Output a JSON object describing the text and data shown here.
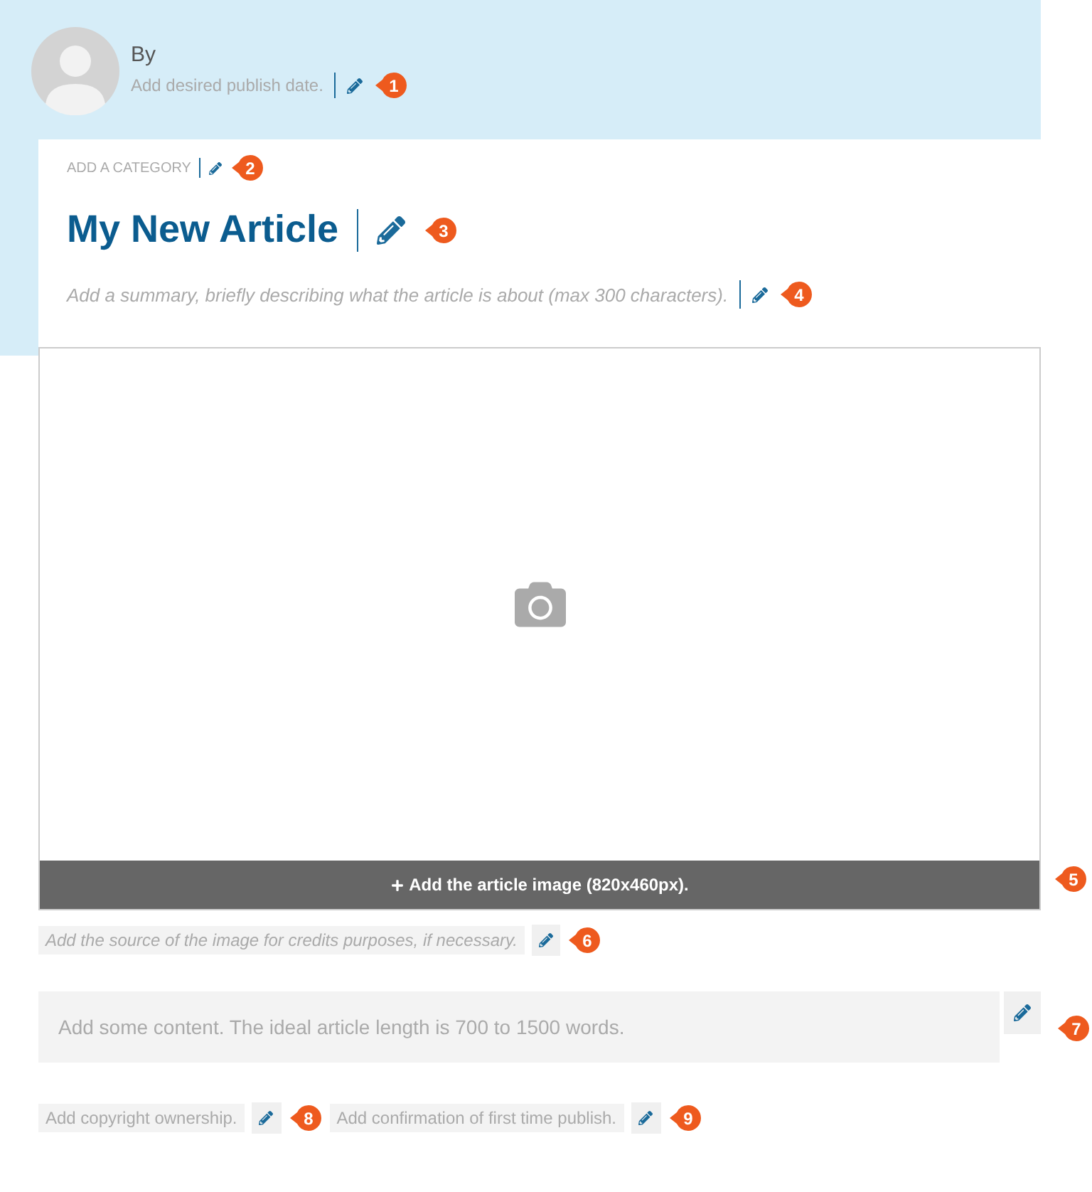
{
  "header": {
    "author_label": "By",
    "publish_date_placeholder": "Add desired publish date.",
    "badge": "1"
  },
  "category": {
    "placeholder": "ADD A CATEGORY",
    "badge": "2"
  },
  "title": {
    "text": "My New Article",
    "badge": "3"
  },
  "summary": {
    "placeholder": "Add a summary, briefly describing what the article is about (max 300 characters).",
    "badge": "4"
  },
  "image": {
    "button": "Add the article image (820x460px).",
    "badge": "5"
  },
  "image_source": {
    "placeholder": "Add the source of the image for credits purposes, if necessary.",
    "badge": "6"
  },
  "content": {
    "placeholder": "Add some content. The ideal article length is 700 to 1500 words.",
    "badge": "7"
  },
  "footer_fields": [
    {
      "placeholder": "Add copyright ownership.",
      "badge": "8"
    },
    {
      "placeholder": "Add confirmation of first time publish.",
      "badge": "9"
    }
  ]
}
